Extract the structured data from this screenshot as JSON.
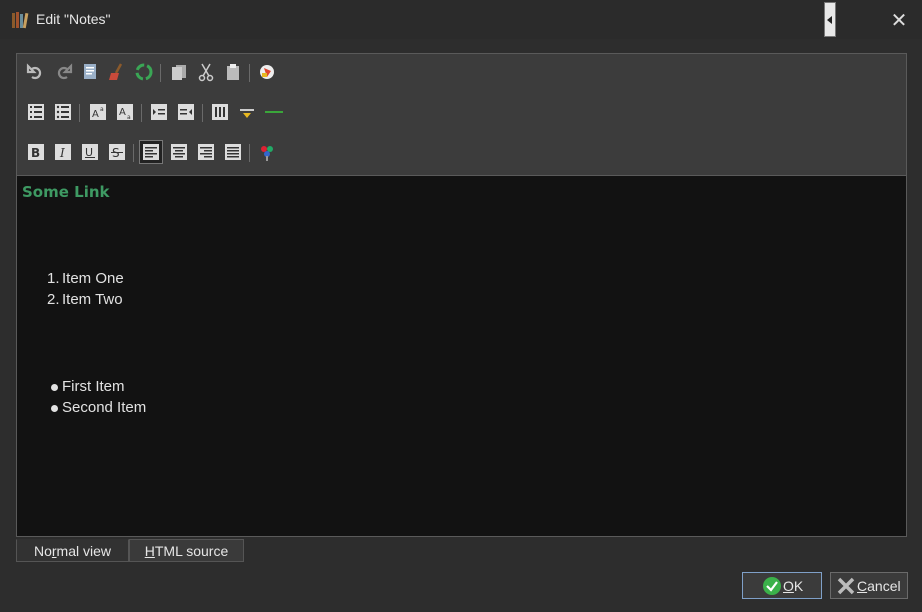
{
  "window": {
    "title": "Edit \"Notes\""
  },
  "editor": {
    "link_text": "Some Link",
    "ordered_list": [
      {
        "num": "1.",
        "text": "Item One"
      },
      {
        "num": "2.",
        "text": "Item Two"
      }
    ],
    "bullet_list": [
      {
        "text": "First Item"
      },
      {
        "text": "Second Item"
      }
    ]
  },
  "tabs": {
    "normal_view": {
      "pre": "No",
      "accel": "r",
      "post": "mal view"
    },
    "html_source": {
      "pre": "",
      "accel": "H",
      "post": "TML source"
    }
  },
  "buttons": {
    "ok": {
      "accel": "O",
      "rest": "K"
    },
    "cancel": {
      "accel": "C",
      "rest": "ancel"
    }
  },
  "colors": {
    "link": "#3e9a63",
    "ok_check": "#3bb14a",
    "hr_line": "#3aa63a"
  }
}
